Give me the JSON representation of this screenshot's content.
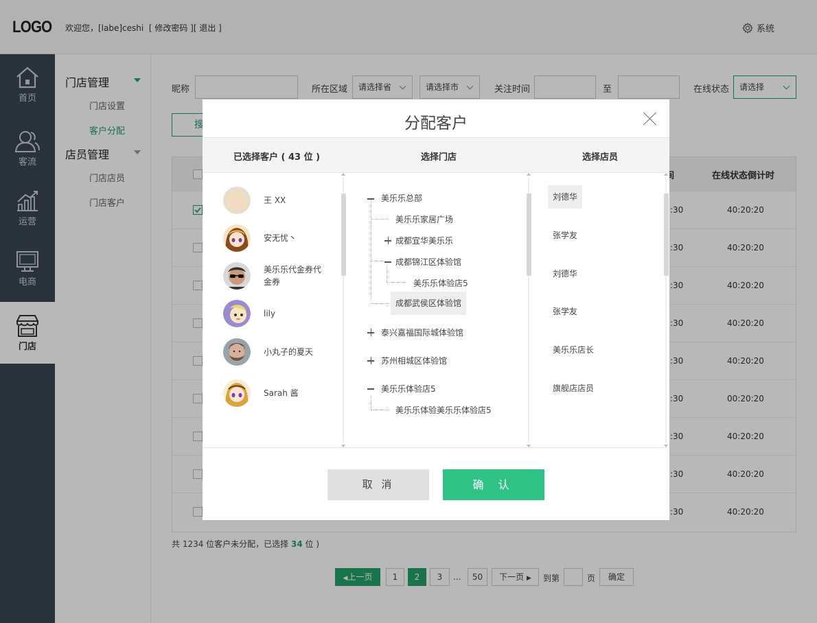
{
  "header": {
    "logo": "LOGO",
    "welcome": "欢迎您，[labe]ceshi",
    "change_password": "[ 修改密码 ]",
    "logout": "[ 退出 ]",
    "system": "系统"
  },
  "rail": [
    {
      "label": "首页",
      "icon": "home-icon"
    },
    {
      "label": "客流",
      "icon": "people-icon"
    },
    {
      "label": "运营",
      "icon": "trend-chart-icon"
    },
    {
      "label": "电商",
      "icon": "monitor-icon"
    },
    {
      "label": "门店",
      "icon": "store-icon",
      "active": true
    }
  ],
  "submenu": {
    "group1": "门店管理",
    "group1_items": [
      "门店设置",
      "客户分配"
    ],
    "group2": "店员管理",
    "group2_items": [
      "门店店员",
      "门店客户"
    ]
  },
  "filters": {
    "nickname_label": "昵称",
    "region_label": "所在区域",
    "province_placeholder": "请选择省",
    "city_placeholder": "请选择市",
    "follow_time_label": "关注时间",
    "to_label": "至",
    "online_status_label": "在线状态",
    "online_status_value": "请选择",
    "search_button": "搜"
  },
  "table": {
    "header_partial": "间",
    "header_countdown": "在线状态倒计时",
    "rows": [
      {
        "time": ":30",
        "countdown": "40:20:20",
        "checked": true
      },
      {
        "time": ":30",
        "countdown": "40:20:20"
      },
      {
        "time": ":30",
        "countdown": "40:20:20"
      },
      {
        "time": ":30",
        "countdown": "40:20:20"
      },
      {
        "time": ":30",
        "countdown": "40:20:20"
      },
      {
        "time": ":30",
        "countdown": "00:20:20"
      },
      {
        "time": ":30",
        "countdown": "40:20:20"
      },
      {
        "time": ":30",
        "countdown": "40:20:20"
      },
      {
        "time": ":30",
        "countdown": "40:20:20"
      }
    ]
  },
  "footnote": {
    "prefix": "共 1234 位客户未分配，已选择",
    "selected": "34",
    "suffix": "位 )"
  },
  "pagination": {
    "prev": "上一页",
    "pages": [
      "1",
      "2",
      "3"
    ],
    "current": "2",
    "ellipsis": "...",
    "last": "50",
    "next": "下一页",
    "goto": "到第",
    "page_unit": "页",
    "confirm": "确定"
  },
  "modal": {
    "title": "分配客户",
    "col_selected": "已选择客户 ( 43 位 )",
    "col_store": "选择门店",
    "col_staff": "选择店员",
    "customers": [
      {
        "name": "王 XX",
        "avatar": "blonde-avatar"
      },
      {
        "name": "安无忧丶",
        "avatar": "anime-girl-avatar"
      },
      {
        "name": "美乐乐代金券代金券",
        "avatar": "sunglasses-man-avatar"
      },
      {
        "name": "lily",
        "avatar": "cartoon-purple-avatar"
      },
      {
        "name": "小丸子的夏天",
        "avatar": "bearded-man-avatar"
      },
      {
        "name": "Sarah 酱",
        "avatar": "anime-purple-avatar"
      }
    ],
    "tree": [
      {
        "label": "美乐乐总部",
        "sign": "minus"
      },
      {
        "label": "美乐乐家居广场"
      },
      {
        "label": "成都宜华美乐乐",
        "sign": "plus"
      },
      {
        "label": "成都锦江区体验馆",
        "sign": "minus"
      },
      {
        "label": "美乐乐体验店5"
      },
      {
        "label": "成都武侯区体验馆",
        "selected": true
      },
      {
        "label": "泰兴嘉福国际城体验馆",
        "sign": "plus"
      },
      {
        "label": "苏州相城区体验馆",
        "sign": "plus"
      },
      {
        "label": "美乐乐体验店5",
        "sign": "minus"
      },
      {
        "label": "美乐乐体验美乐乐体验店5"
      }
    ],
    "staff": [
      "刘德华",
      "张学友",
      "刘德华",
      "张学友",
      "美乐乐店长",
      "旗舰店店员"
    ],
    "cancel": "取 消",
    "confirm": "确 认"
  },
  "colors": {
    "accent": "#23a06b",
    "confirm_button": "#2ec287",
    "rail_bg": "#3a4452"
  }
}
